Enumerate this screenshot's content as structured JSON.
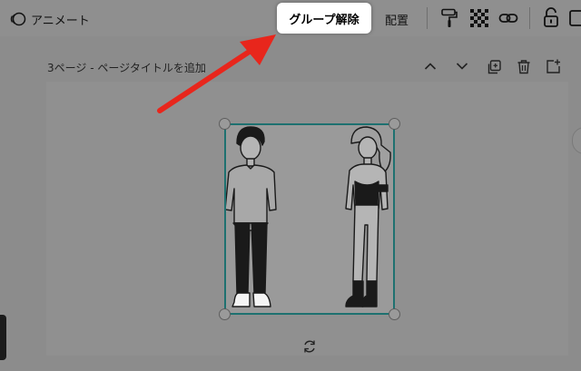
{
  "toolbar": {
    "animate_label": "アニメート",
    "group_release_label": "グループ解除",
    "arrange_label": "配置"
  },
  "page": {
    "title": "3ページ - ページタイトルを追加"
  },
  "icons": {
    "animate": "animate-icon",
    "paint_roller": "paint-roller-icon",
    "transparency": "transparency-icon",
    "link": "link-icon",
    "lock": "lock-icon",
    "duplicate_element": "duplicate-element-icon",
    "collapse": "chevron-up-icon",
    "expand": "chevron-down-icon",
    "copy_page": "copy-page-icon",
    "delete_page": "trash-icon",
    "add_page": "add-page-icon",
    "rotate": "rotate-icon"
  },
  "colors": {
    "selection_border": "#1e7170",
    "arrow": "#e8261c",
    "highlight_button_bg": "#ffffff"
  }
}
